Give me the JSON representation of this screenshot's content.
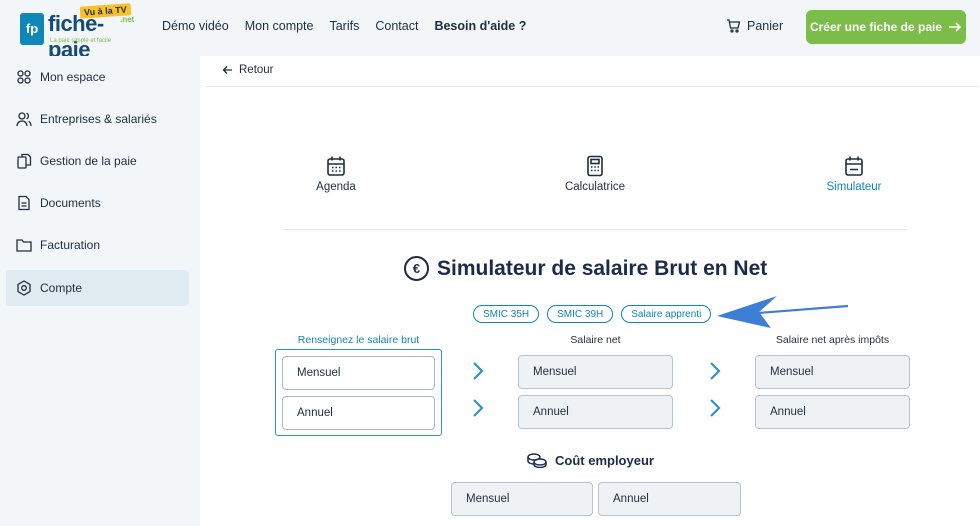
{
  "header": {
    "logo": {
      "badge": "fp",
      "title": "fiche-paie",
      "tv": "Vu à la TV",
      "net": ".net",
      "tagline": "La paie simple et facile"
    },
    "nav": [
      "Démo vidéo",
      "Mon compte",
      "Tarifs",
      "Contact",
      "Besoin d'aide ?"
    ],
    "cart_label": "Panier",
    "cta_label": "Créer une fiche de paie",
    "colors": {
      "cta": "#7cbc49",
      "accent": "#0f87b8"
    }
  },
  "sidebar": {
    "items": [
      {
        "label": "Mon espace",
        "icon": "grid-icon"
      },
      {
        "label": "Entreprises & salariés",
        "icon": "users-icon"
      },
      {
        "label": "Gestion de la paie",
        "icon": "documents-icon"
      },
      {
        "label": "Documents",
        "icon": "document-icon"
      },
      {
        "label": "Facturation",
        "icon": "folder-icon"
      },
      {
        "label": "Compte",
        "icon": "gear-icon",
        "active": true
      }
    ]
  },
  "main": {
    "back_label": "Retour",
    "tools": [
      {
        "label": "Agenda",
        "icon": "calendar-icon"
      },
      {
        "label": "Calculatrice",
        "icon": "calculator-icon"
      },
      {
        "label": "Simulateur",
        "icon": "calendar-check-icon",
        "active": true
      }
    ],
    "title": "Simulateur de salaire Brut en Net",
    "title_icon": "euro-icon",
    "presets": [
      "SMIC 35H",
      "SMIC 39H",
      "Salaire apprenti"
    ],
    "columns": {
      "brut": {
        "label": "Renseignez le salaire brut",
        "monthly_placeholder": "Mensuel",
        "yearly_placeholder": "Annuel"
      },
      "net": {
        "label": "Salaire net",
        "monthly_placeholder": "Mensuel",
        "yearly_placeholder": "Annuel"
      },
      "net_after_tax": {
        "label": "Salaire net après impôts",
        "monthly_placeholder": "Mensuel",
        "yearly_placeholder": "Annuel"
      }
    },
    "employer_cost": {
      "title": "Coût employeur",
      "icon": "coins-icon",
      "monthly_placeholder": "Mensuel",
      "yearly_placeholder": "Annuel"
    }
  }
}
